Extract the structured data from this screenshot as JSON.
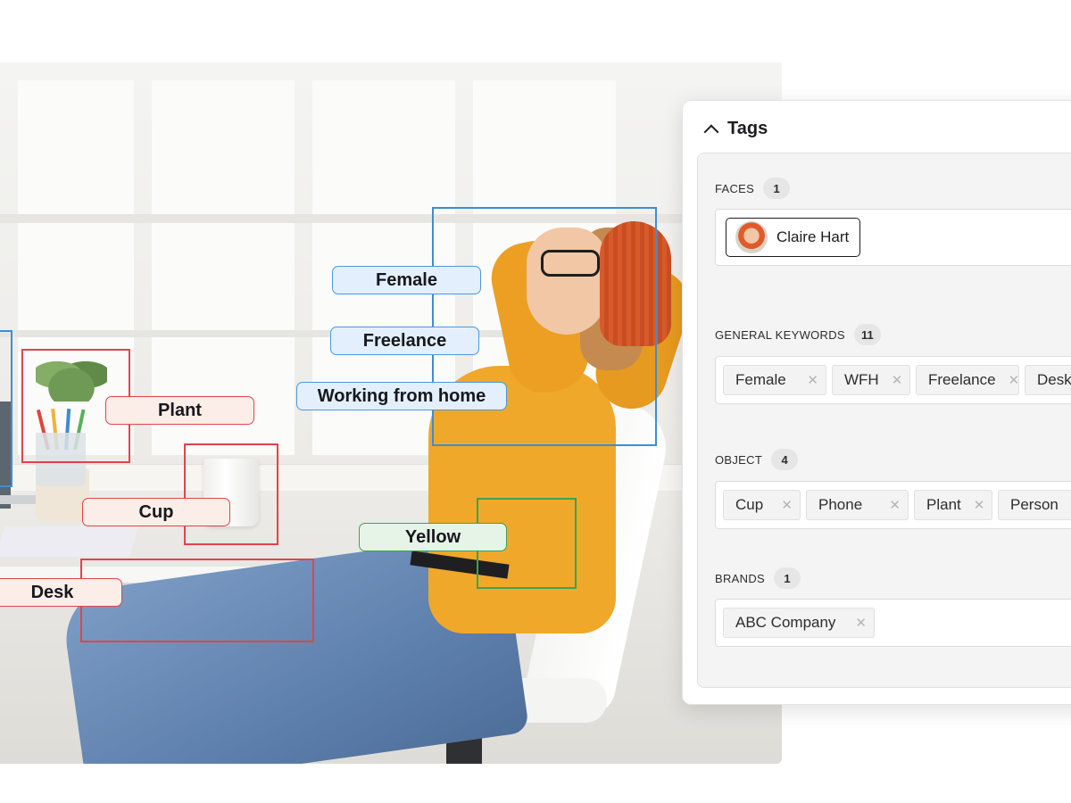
{
  "annotations": {
    "female": "Female",
    "freelance": "Freelance",
    "working_from_home": "Working from home",
    "plant": "Plant",
    "cup": "Cup",
    "desk": "Desk",
    "yellow": "Yellow"
  },
  "panel": {
    "title": "Tags",
    "faces": {
      "title": "FACES",
      "count": "1",
      "items": [
        {
          "name": "Claire Hart"
        }
      ]
    },
    "general_keywords": {
      "title": "GENERAL KEYWORDS",
      "count": "11",
      "items": [
        "Female",
        "WFH",
        "Freelance",
        "Desk"
      ]
    },
    "object": {
      "title": "OBJECT",
      "count": "4",
      "items": [
        "Cup",
        "Phone",
        "Plant",
        "Person"
      ]
    },
    "brands": {
      "title": "BRANDS",
      "count": "1",
      "items": [
        "ABC Company"
      ]
    },
    "remove_glyph": "✕"
  },
  "colors": {
    "person_box": "#3b8fd4",
    "object_box": "#e4424d",
    "color_box": "#3aa354"
  }
}
